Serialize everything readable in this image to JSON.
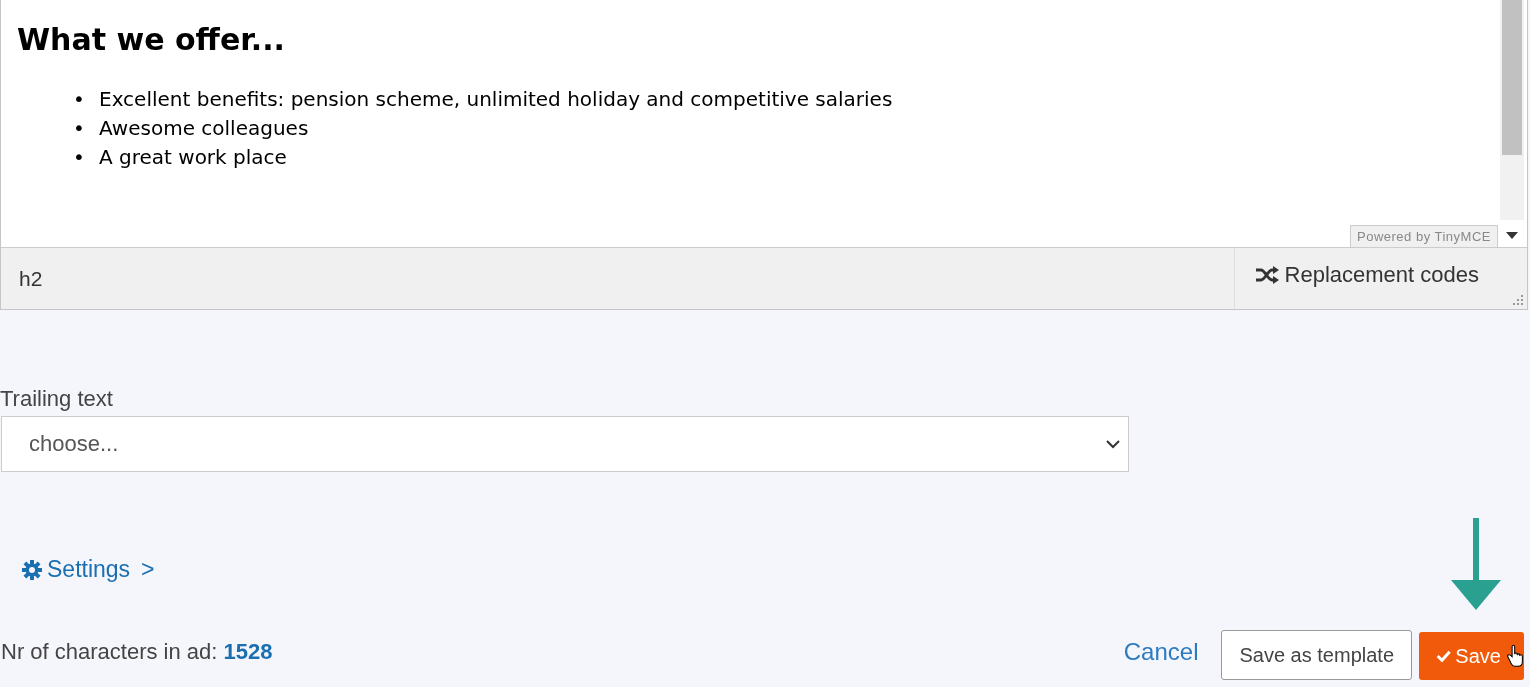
{
  "editor": {
    "heading": "What we offer...",
    "bullets": [
      {
        "marker": "•",
        "text": "Excellent benefits: pension scheme, unlimited holiday and competitive salaries"
      },
      {
        "marker": "•",
        "text": "Awesome colleagues"
      },
      {
        "marker": "•",
        "text": "A great work place"
      }
    ],
    "branding": "Powered by TinyMCE",
    "path": "h2",
    "replacement_button": "Replacement codes"
  },
  "trailing_text": {
    "label": "Trailing text",
    "placeholder": "choose..."
  },
  "settings_link": {
    "label": "Settings",
    "chevron": ">"
  },
  "char_count": {
    "label": "Nr of characters in ad:",
    "value": "1528"
  },
  "actions": {
    "cancel": "Cancel",
    "template": "Save as template",
    "save": "Save"
  }
}
